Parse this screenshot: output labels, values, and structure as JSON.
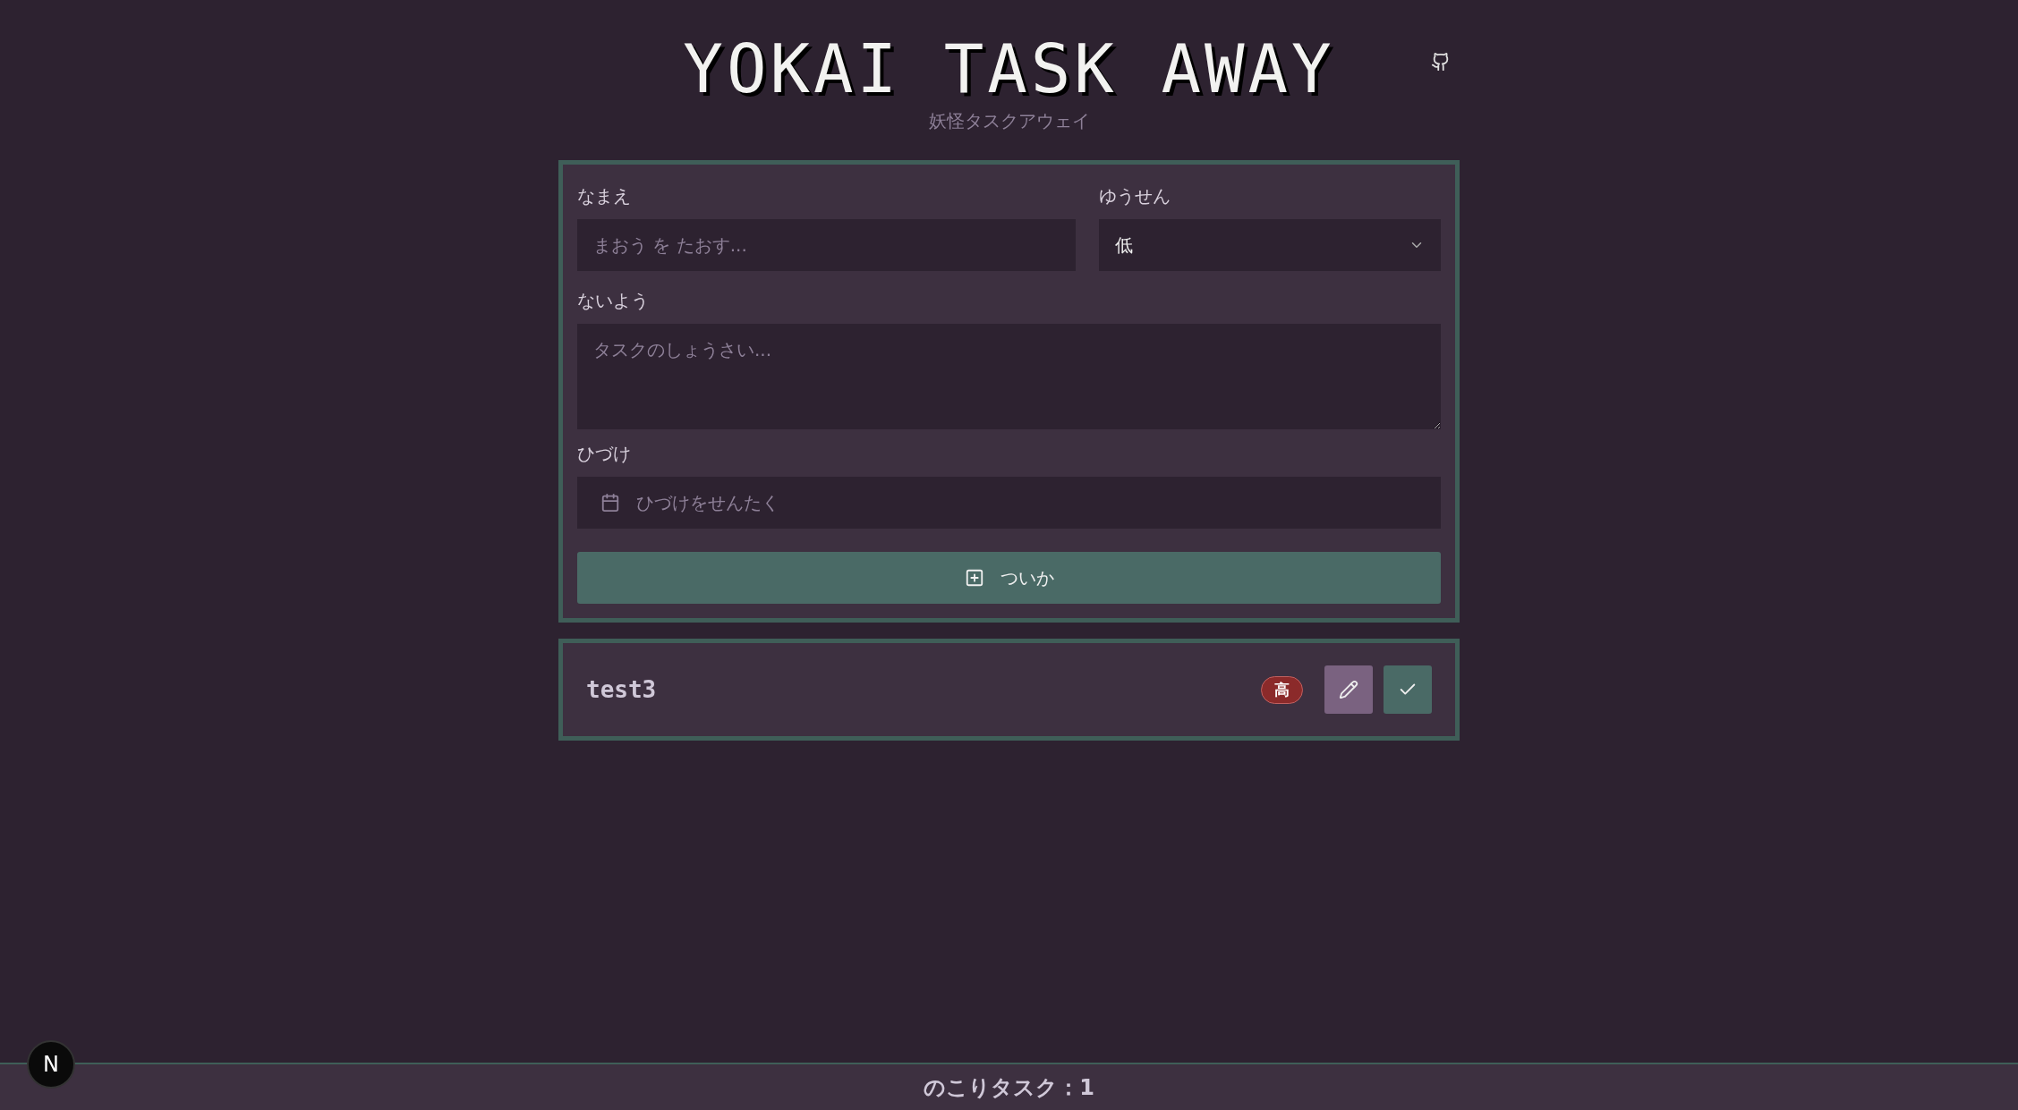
{
  "header": {
    "title": "YOKAI TASK AWAY",
    "subtitle": "妖怪タスクアウェイ"
  },
  "form": {
    "name_label": "なまえ",
    "name_placeholder": "まおう を たおす...",
    "priority_label": "ゆうせん",
    "priority_value": "低",
    "content_label": "ないよう",
    "content_placeholder": "タスクのしょうさい...",
    "date_label": "ひづけ",
    "date_placeholder": "ひづけをせんたく",
    "add_button": "ついか"
  },
  "tasks": [
    {
      "name": "test3",
      "priority": "高",
      "color": "#8b2a2a"
    }
  ],
  "footer": {
    "remaining": "のこりタスク：1"
  },
  "dev_badge": {
    "label": "N"
  }
}
